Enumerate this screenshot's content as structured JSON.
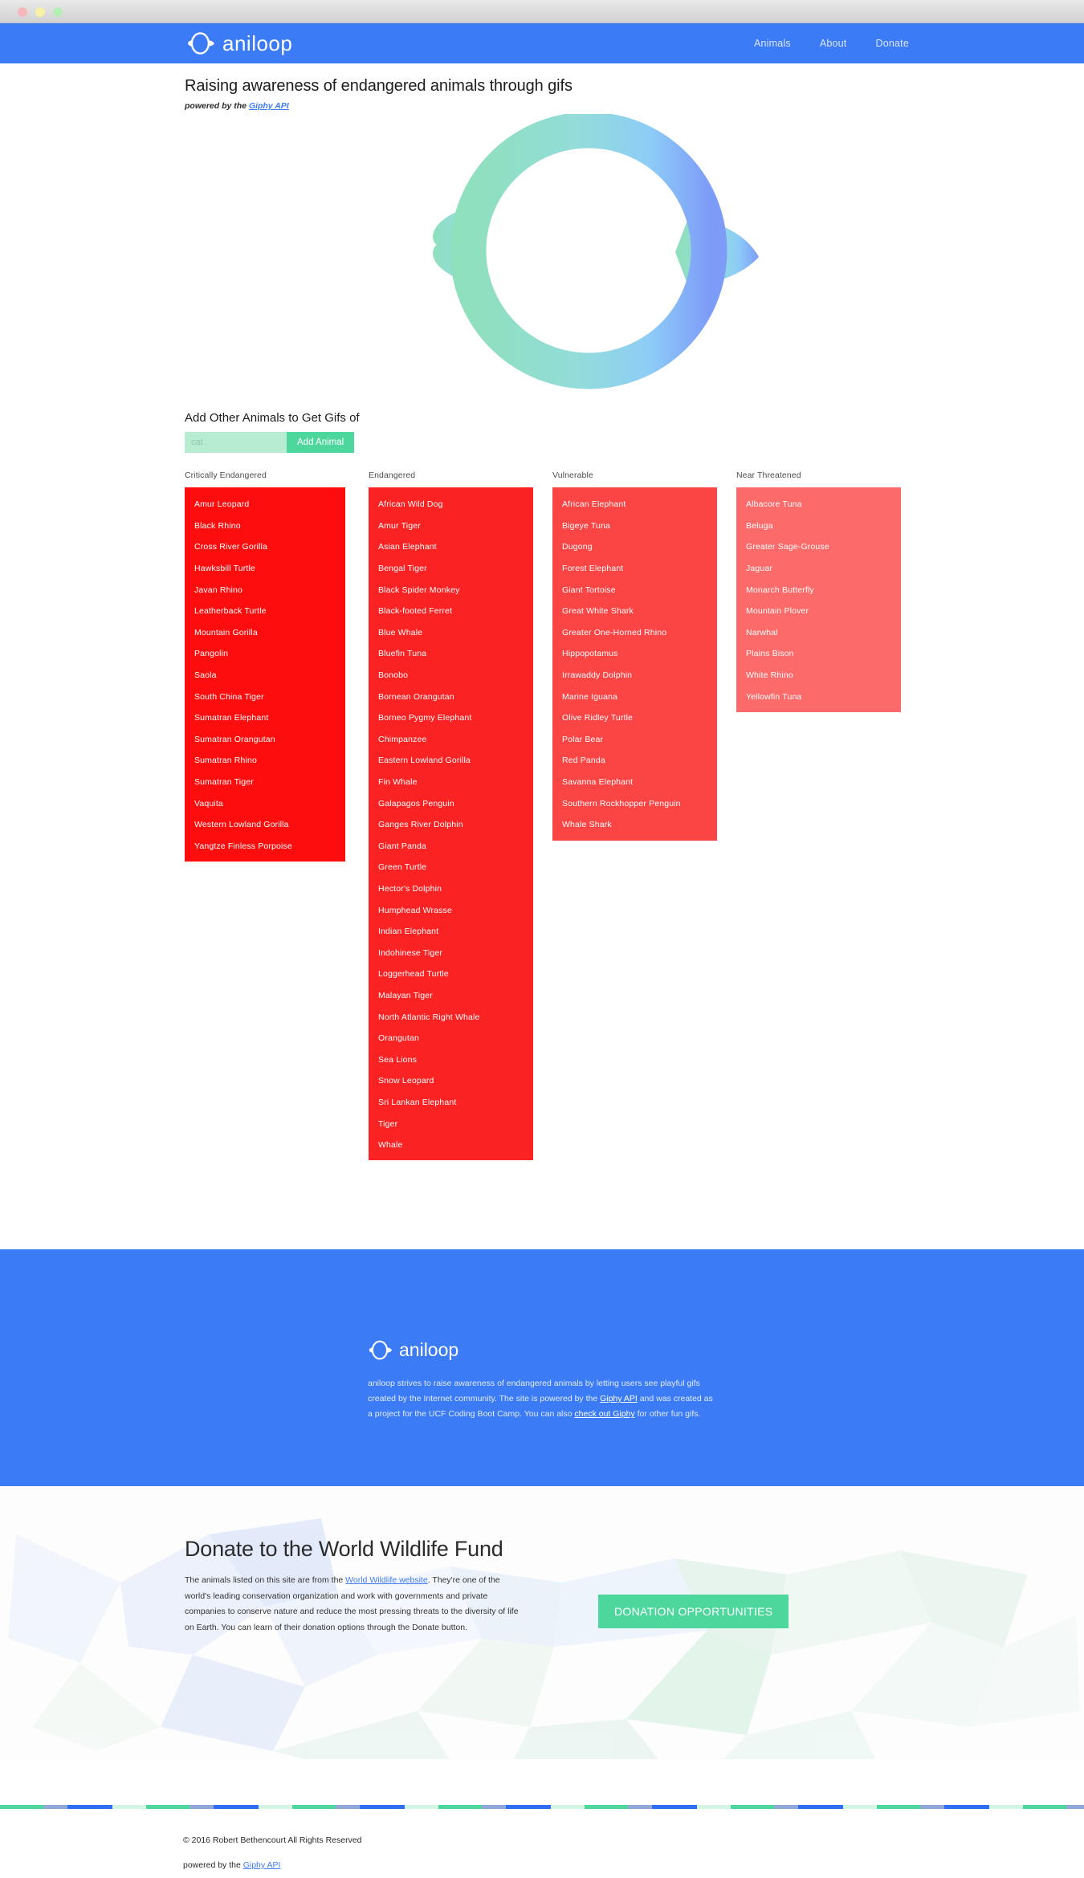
{
  "window": {
    "traffic_lights": [
      "close",
      "minimize",
      "zoom"
    ]
  },
  "nav": {
    "brand": "aniloop",
    "links": [
      {
        "label": "Animals"
      },
      {
        "label": "About"
      },
      {
        "label": "Donate"
      }
    ]
  },
  "hero": {
    "title": "Raising awareness of endangered animals through gifs",
    "powered_prefix": "powered by the ",
    "powered_link": "Giphy API",
    "logo_icon": "aniloop-bird-ring-logo"
  },
  "add_animal": {
    "label": "Add Other Animals to Get Gifs of",
    "placeholder": "cat",
    "value": "",
    "button": "Add Animal"
  },
  "columns": [
    {
      "heading": "Critically Endangered",
      "color": "#fd0d0d",
      "animals": [
        "Amur Leopard",
        "Black Rhino",
        "Cross River Gorilla",
        "Hawksbill Turtle",
        "Javan Rhino",
        "Leatherback Turtle",
        "Mountain Gorilla",
        "Pangolin",
        "Saola",
        "South China Tiger",
        "Sumatran Elephant",
        "Sumatran Orangutan",
        "Sumatran Rhino",
        "Sumatran Tiger",
        "Vaquita",
        "Western Lowland Gorilla",
        "Yangtze Finless Porpoise"
      ]
    },
    {
      "heading": "Endangered",
      "color": "#fa2222",
      "animals": [
        "African Wild Dog",
        "Amur Tiger",
        "Asian Elephant",
        "Bengal Tiger",
        "Black Spider Monkey",
        "Black-footed Ferret",
        "Blue Whale",
        "Bluefin Tuna",
        "Bonobo",
        "Bornean Orangutan",
        "Borneo Pygmy Elephant",
        "Chimpanzee",
        "Eastern Lowland Gorilla",
        "Fin Whale",
        "Galapagos Penguin",
        "Ganges River Dolphin",
        "Giant Panda",
        "Green Turtle",
        "Hector's Dolphin",
        "Humphead Wrasse",
        "Indian Elephant",
        "Indohinese Tiger",
        "Loggerhead Turtle",
        "Malayan Tiger",
        "North Atlantic Right Whale",
        "Orangutan",
        "Sea Lions",
        "Snow Leopard",
        "Sri Lankan Elephant",
        "Tiger",
        "Whale"
      ]
    },
    {
      "heading": "Vulnerable",
      "color": "#fb4444",
      "animals": [
        "African Elephant",
        "Bigeye Tuna",
        "Dugong",
        "Forest Elephant",
        "Giant Tortoise",
        "Great White Shark",
        "Greater One-Horned Rhino",
        "Hippopotamus",
        "Irrawaddy Dolphin",
        "Marine Iguana",
        "Olive Ridley Turtle",
        "Polar Bear",
        "Red Panda",
        "Savanna Elephant",
        "Southern Rockhopper Penguin",
        "Whale Shark"
      ]
    },
    {
      "heading": "Near Threatened",
      "color": "#fc6a6a",
      "animals": [
        "Albacore Tuna",
        "Beluga",
        "Greater Sage-Grouse",
        "Jaguar",
        "Monarch Butterfly",
        "Mountain Plover",
        "Narwhal",
        "Plains Bison",
        "White Rhino",
        "Yellowfin Tuna"
      ]
    }
  ],
  "about": {
    "brand": "aniloop",
    "text_1": "aniloop strives to raise awareness of endangered animals by letting users see playful gifs created by the Internet community. The site is powered by the ",
    "link_1": "Giphy API",
    "text_2": " and was created as a project for the UCF Coding Boot Camp. You can also ",
    "link_2": "check out Giphy",
    "text_3": " for other fun gifs."
  },
  "donate": {
    "title": "Donate to the World Wildlife Fund",
    "text_1": "The animals listed on this site are from the ",
    "link_1": "World Wildlife website",
    "text_2": ". They're one of the world's leading conservation organization and work with governments and private companies to conserve nature and reduce the most pressing threats to the diversity of life on Earth. You can learn of their donation options through the Donate button.",
    "button": "DONATION OPPORTUNITIES"
  },
  "footer": {
    "copyright": "© 2016 Robert Bethencourt All Rights Reserved",
    "powered_prefix": "powered by the ",
    "powered_link": "Giphy API"
  },
  "theme": {
    "brand_blue": "#3c7bf6",
    "accent_green": "#4ed79d",
    "input_green": "#b7ecd2"
  }
}
